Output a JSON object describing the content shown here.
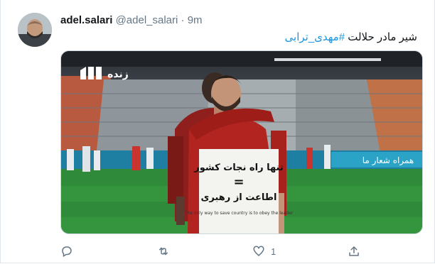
{
  "tweet": {
    "author_name": "adel.salari",
    "handle": "@adel_salari",
    "separator": "·",
    "time": "9m",
    "text_prefix": "شیر مادر حلالت",
    "hashtag": "#مهدی_ترابی"
  },
  "media": {
    "channel_logo_text": "زنده",
    "shirt_line1": "تنها راه نجات کشور",
    "shirt_equals": "=",
    "shirt_line2": "اطاعت از رهبری",
    "shirt_english": "The only way to save country is to obey the leader",
    "board_text": "همراه شعار ما"
  },
  "actions": {
    "reply_icon": "reply-icon",
    "retweet_icon": "retweet-icon",
    "like_icon": "heart-icon",
    "like_count": "1",
    "share_icon": "share-icon"
  },
  "colors": {
    "link": "#1b95e0",
    "secondary_text": "#657786",
    "border": "#e1e8ed"
  }
}
